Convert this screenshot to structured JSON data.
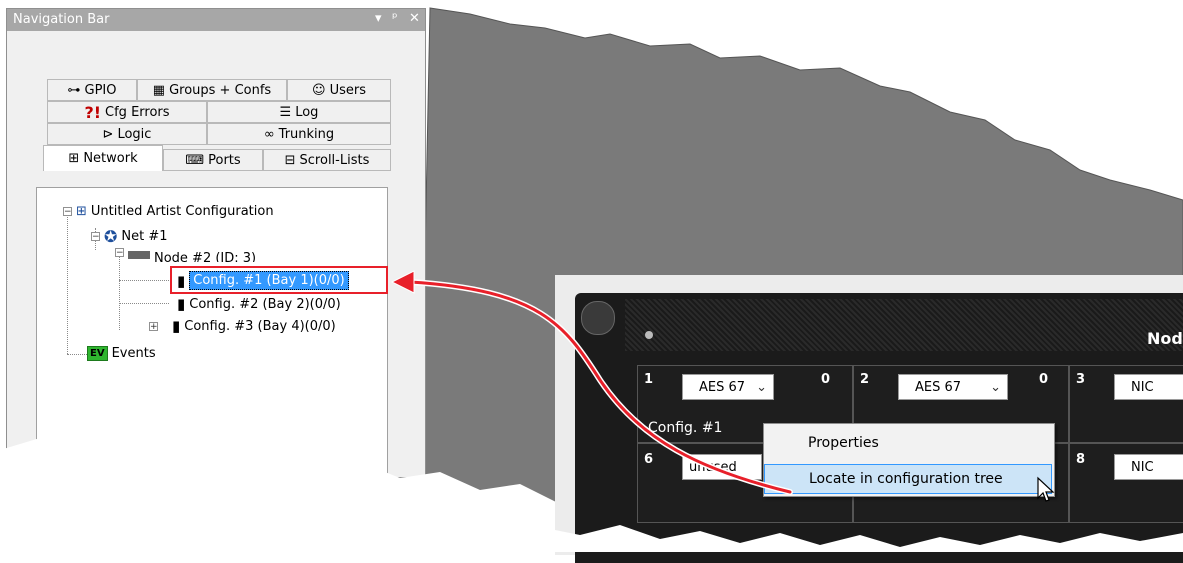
{
  "nav": {
    "title": "Navigation Bar",
    "controls": [
      "▾",
      "ᵖ",
      "✕"
    ]
  },
  "tabs": {
    "gpio": "GPIO",
    "groups": "Groups + Confs",
    "users": "Users",
    "cfg_errors": "Cfg Errors",
    "log": "Log",
    "logic": "Logic",
    "trunking": "Trunking",
    "network": "Network",
    "ports": "Ports",
    "scroll_lists": "Scroll-Lists"
  },
  "tree": {
    "root": "Untitled Artist Configuration",
    "net": "Net #1",
    "node": "Node #2 (ID: 3)",
    "config1": "Config. #1 (Bay  1)(0/0)",
    "config2": "Config. #2 (Bay  2)(0/0)",
    "config3": "Config. #3 (Bay  4)(0/0)",
    "events": "Events",
    "events_badge": "EV"
  },
  "device": {
    "header": "Nod",
    "slots": [
      {
        "num": "1",
        "value": "AES 67",
        "count": "0"
      },
      {
        "num": "2",
        "value": "AES 67",
        "count": "0"
      },
      {
        "num": "3",
        "value": "NIC"
      },
      {
        "num": "6",
        "value": "unused"
      },
      {
        "num": "8",
        "value": "NIC"
      }
    ],
    "config_label": "Config. #1"
  },
  "context_menu": {
    "items": [
      "Properties",
      "Locate in configuration tree"
    ]
  },
  "colors": {
    "highlight": "#3399ff",
    "red": "#e8202a",
    "device_bg": "#1b1b1b"
  }
}
